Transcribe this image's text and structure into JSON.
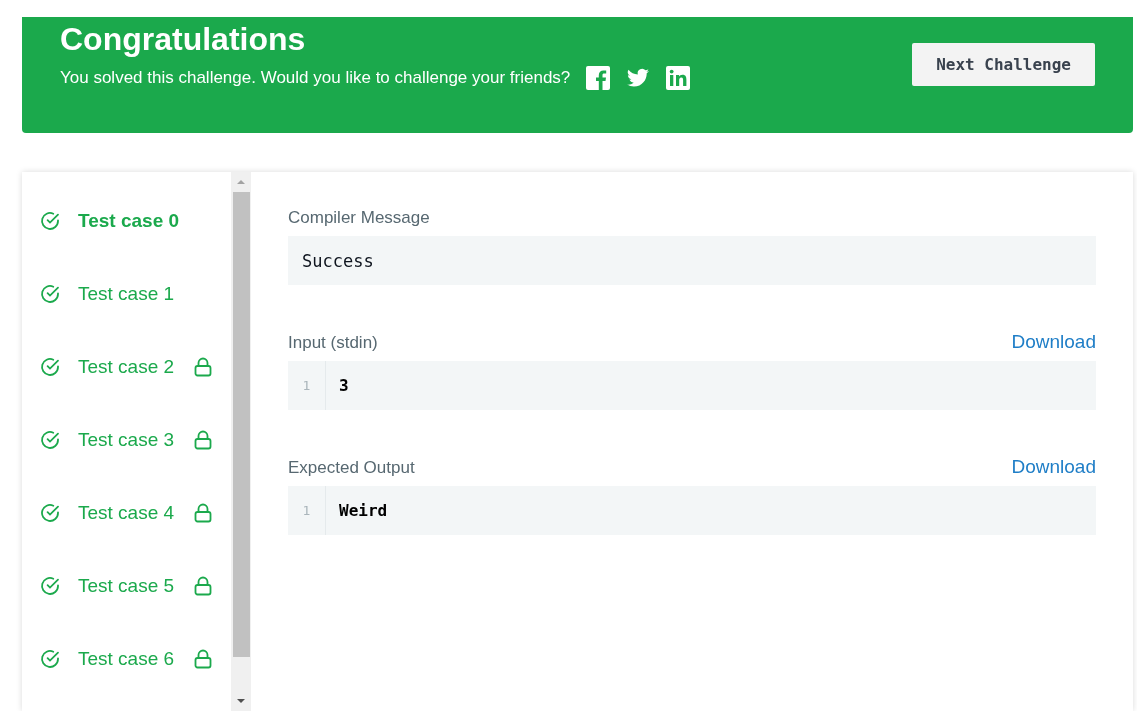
{
  "banner": {
    "title": "Congratulations",
    "message": "You solved this challenge. Would you like to challenge your friends?",
    "share": [
      {
        "kind": "facebook"
      },
      {
        "kind": "twitter"
      },
      {
        "kind": "linkedin"
      }
    ],
    "button": "Next Challenge"
  },
  "test_cases": [
    {
      "label": "Test case 0",
      "selected": true,
      "locked": false
    },
    {
      "label": "Test case 1",
      "selected": false,
      "locked": false
    },
    {
      "label": "Test case 2",
      "selected": false,
      "locked": true
    },
    {
      "label": "Test case 3",
      "selected": false,
      "locked": true
    },
    {
      "label": "Test case 4",
      "selected": false,
      "locked": true
    },
    {
      "label": "Test case 5",
      "selected": false,
      "locked": true
    },
    {
      "label": "Test case 6",
      "selected": false,
      "locked": true
    }
  ],
  "sections": [
    {
      "kind": "message",
      "title": "Compiler Message",
      "text": "Success"
    },
    {
      "kind": "code",
      "title": "Input (stdin)",
      "link": "Download",
      "lines": [
        {
          "number": "1",
          "text": "3"
        }
      ]
    },
    {
      "kind": "code",
      "title": "Expected Output",
      "link": "Download",
      "lines": [
        {
          "number": "1",
          "text": "Weird"
        }
      ]
    }
  ]
}
